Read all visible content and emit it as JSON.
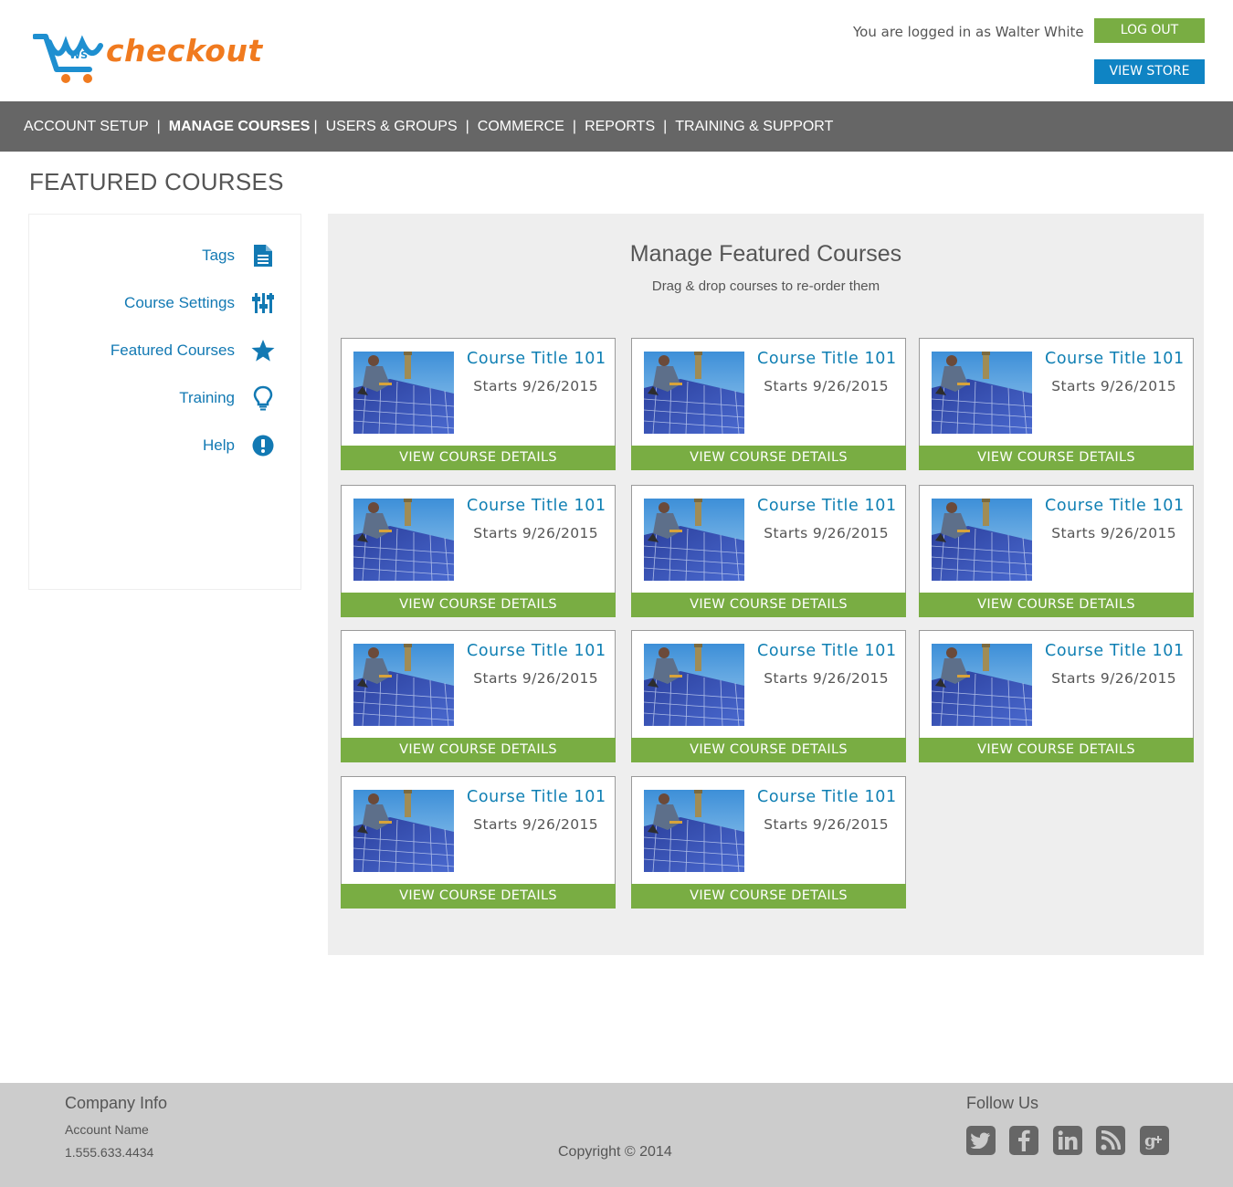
{
  "header": {
    "logo_text": "checkout",
    "logo_badge": "WS",
    "logged_in_text": "You are logged in as Walter White",
    "logout_label": "LOG OUT",
    "view_store_label": "VIEW STORE"
  },
  "nav": {
    "items": [
      {
        "label": "ACCOUNT SETUP"
      },
      {
        "label": "MANAGE COURSES"
      },
      {
        "label": "USERS & GROUPS"
      },
      {
        "label": "COMMERCE"
      },
      {
        "label": "REPORTS"
      },
      {
        "label": "TRAINING & SUPPORT"
      }
    ],
    "active": "MANAGE COURSES",
    "separator": "|"
  },
  "page_title": "FEATURED COURSES",
  "sidebar": {
    "items": [
      {
        "label": "Tags",
        "icon": "document-icon"
      },
      {
        "label": "Course Settings",
        "icon": "sliders-icon"
      },
      {
        "label": "Featured Courses",
        "icon": "star-icon"
      },
      {
        "label": "Training",
        "icon": "lightbulb-icon"
      },
      {
        "label": "Help",
        "icon": "exclamation-icon"
      }
    ]
  },
  "panel": {
    "title": "Manage Featured Courses",
    "subtitle": "Drag & drop courses to re-order them",
    "courses": [
      {
        "title": "Course Title 101",
        "date": "Starts 9/26/2015",
        "button": "VIEW COURSE DETAILS"
      },
      {
        "title": "Course Title 101",
        "date": "Starts 9/26/2015",
        "button": "VIEW COURSE DETAILS"
      },
      {
        "title": "Course Title 101",
        "date": "Starts 9/26/2015",
        "button": "VIEW COURSE DETAILS"
      },
      {
        "title": "Course Title 101",
        "date": "Starts 9/26/2015",
        "button": "VIEW COURSE DETAILS"
      },
      {
        "title": "Course Title 101",
        "date": "Starts 9/26/2015",
        "button": "VIEW COURSE DETAILS"
      },
      {
        "title": "Course Title 101",
        "date": "Starts 9/26/2015",
        "button": "VIEW COURSE DETAILS"
      },
      {
        "title": "Course Title 101",
        "date": "Starts 9/26/2015",
        "button": "VIEW COURSE DETAILS"
      },
      {
        "title": "Course Title 101",
        "date": "Starts 9/26/2015",
        "button": "VIEW COURSE DETAILS"
      },
      {
        "title": "Course Title 101",
        "date": "Starts 9/26/2015",
        "button": "VIEW COURSE DETAILS"
      },
      {
        "title": "Course Title 101",
        "date": "Starts 9/26/2015",
        "button": "VIEW COURSE DETAILS"
      },
      {
        "title": "Course Title 101",
        "date": "Starts 9/26/2015",
        "button": "VIEW COURSE DETAILS"
      }
    ]
  },
  "footer": {
    "company_heading": "Company Info",
    "account_name": "Account Name",
    "phone": "1.555.633.4434",
    "copyright": "Copyright © 2014",
    "follow_heading": "Follow Us",
    "social": [
      "twitter-icon",
      "facebook-icon",
      "linkedin-icon",
      "rss-icon",
      "google-plus-icon"
    ]
  },
  "colors": {
    "brand_orange": "#f07a1f",
    "brand_blue": "#0f84c4",
    "link_blue": "#1279b3",
    "green": "#79ad43",
    "nav_gray": "#666666",
    "panel_gray": "#eeeeee",
    "footer_gray": "#cccccc"
  }
}
